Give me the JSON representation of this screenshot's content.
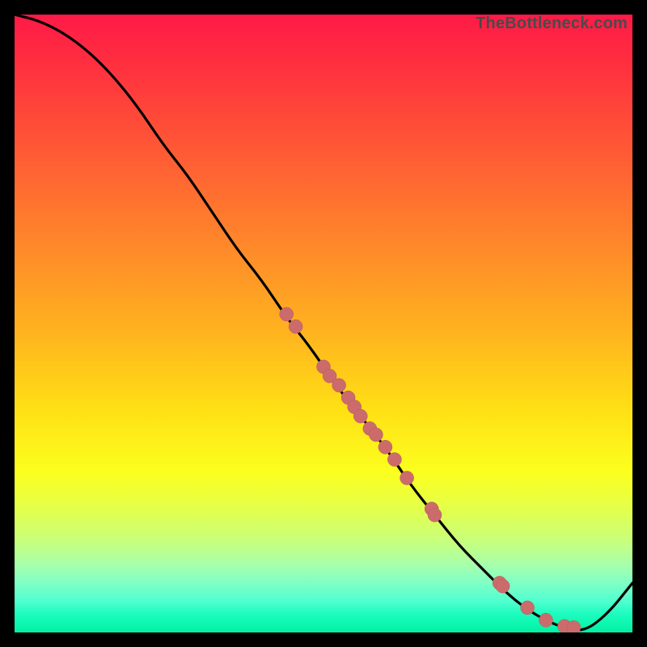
{
  "watermark": "TheBottleneck.com",
  "colors": {
    "dot_fill": "#cc6b6b",
    "dot_stroke": "#b55a5a",
    "curve": "#000000"
  },
  "chart_data": {
    "type": "line",
    "title": "",
    "xlabel": "",
    "ylabel": "",
    "xlim": [
      0,
      100
    ],
    "ylim": [
      0,
      100
    ],
    "series": [
      {
        "name": "bottleneck-curve",
        "x": [
          0,
          4,
          8,
          12,
          16,
          20,
          24,
          28,
          32,
          36,
          40,
          44,
          48,
          52,
          56,
          60,
          64,
          68,
          72,
          76,
          80,
          84,
          88,
          92,
          96,
          100
        ],
        "y": [
          100,
          99,
          97,
          94,
          90,
          85,
          79,
          74,
          68,
          62,
          57,
          51,
          46,
          40,
          35,
          30,
          24,
          19,
          14,
          10,
          6,
          3,
          1,
          0,
          3,
          8
        ]
      }
    ],
    "scatter": [
      {
        "name": "highlighted-points",
        "points": [
          {
            "x": 44.0,
            "y": 51.5
          },
          {
            "x": 45.5,
            "y": 49.5
          },
          {
            "x": 50.0,
            "y": 43.0
          },
          {
            "x": 51.0,
            "y": 41.5
          },
          {
            "x": 52.5,
            "y": 40.0
          },
          {
            "x": 54.0,
            "y": 38.0
          },
          {
            "x": 55.0,
            "y": 36.5
          },
          {
            "x": 56.0,
            "y": 35.0
          },
          {
            "x": 57.5,
            "y": 33.0
          },
          {
            "x": 58.5,
            "y": 32.0
          },
          {
            "x": 60.0,
            "y": 30.0
          },
          {
            "x": 61.5,
            "y": 28.0
          },
          {
            "x": 63.5,
            "y": 25.0
          },
          {
            "x": 67.5,
            "y": 20.0
          },
          {
            "x": 68.0,
            "y": 19.0
          },
          {
            "x": 78.5,
            "y": 8.0
          },
          {
            "x": 79.0,
            "y": 7.5
          },
          {
            "x": 83.0,
            "y": 4.0
          },
          {
            "x": 86.0,
            "y": 2.0
          },
          {
            "x": 89.0,
            "y": 1.0
          },
          {
            "x": 90.5,
            "y": 0.8
          }
        ]
      }
    ]
  }
}
